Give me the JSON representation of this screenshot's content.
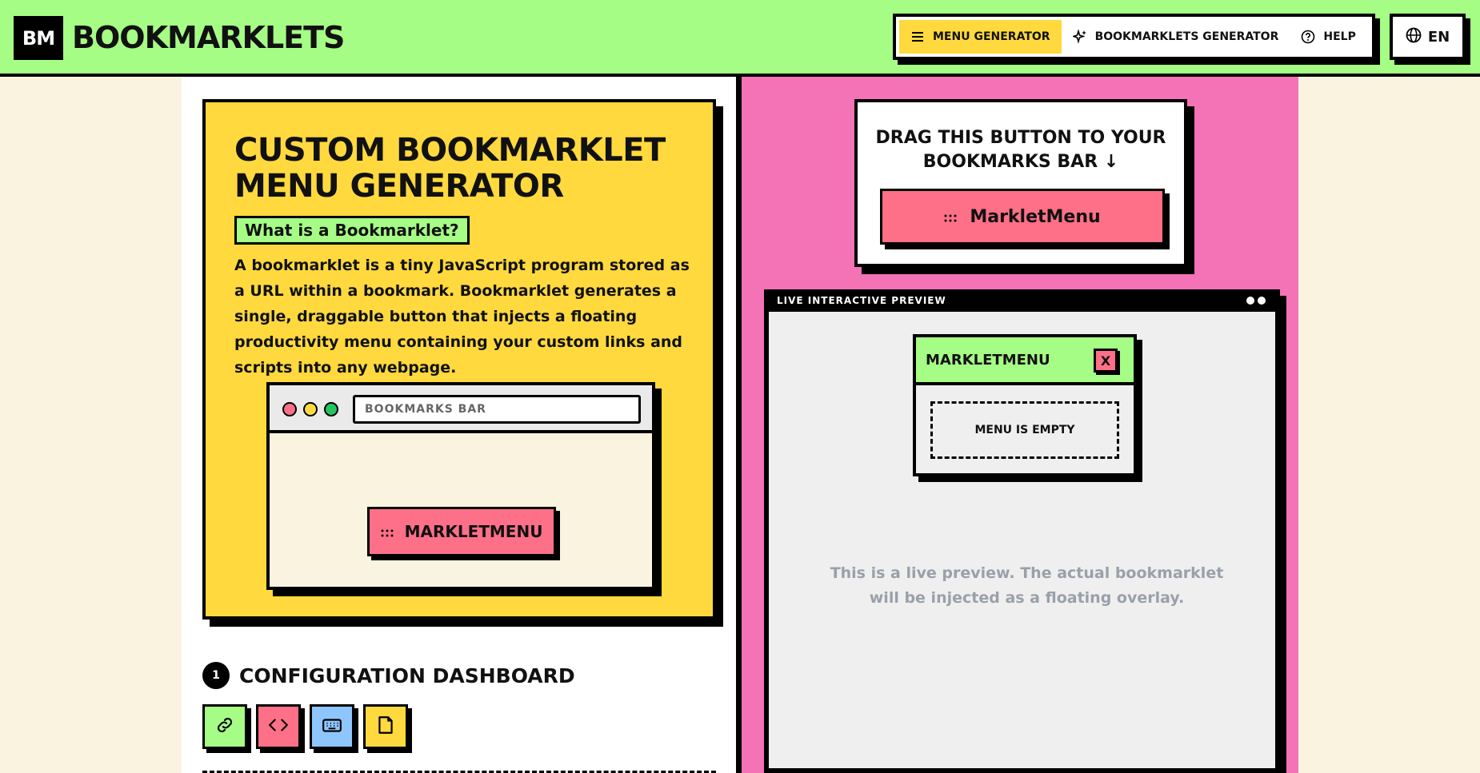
{
  "header": {
    "logo_mark": "BM",
    "logo_text": "BOOKMARKLETS",
    "nav": [
      {
        "label": "MENU GENERATOR",
        "icon": "menu-icon",
        "active": true
      },
      {
        "label": "BOOKMARKLETS GENERATOR",
        "icon": "sparkles-icon",
        "active": false
      },
      {
        "label": "HELP",
        "icon": "help-circle-icon",
        "active": false
      }
    ],
    "language": "EN",
    "language_icon": "globe-icon"
  },
  "hero": {
    "title": "CUSTOM BOOKMARKLET MENU GENERATOR",
    "badge": "What is a Bookmarklet?",
    "description": "A bookmarklet is a tiny JavaScript program stored as a URL within a bookmark. Bookmarklet generates a single, draggable button that injects a floating productivity menu containing your custom links and scripts into any webpage.",
    "browser": {
      "address_bar": "BOOKMARKS BAR",
      "demo_button": "MARKLETMENU"
    }
  },
  "config": {
    "step_number": "1",
    "title": "CONFIGURATION DASHBOARD",
    "tools": [
      {
        "icon": "link-icon",
        "color": "#a6fd86"
      },
      {
        "icon": "code-icon",
        "color": "#fe7087"
      },
      {
        "icon": "keyboard-icon",
        "color": "#8ec5fc"
      },
      {
        "icon": "note-icon",
        "color": "#ffd93d"
      }
    ]
  },
  "drag": {
    "instruction_line1": "DRAG THIS BUTTON TO YOUR",
    "instruction_line2": "BOOKMARKS BAR ↓",
    "button_label": "MarkletMenu"
  },
  "preview": {
    "header": "LIVE INTERACTIVE PREVIEW",
    "menu_title": "MARKLETMENU",
    "close_label": "X",
    "empty_label": "MENU IS EMPTY",
    "note": "This is a live preview. The actual bookmarklet will be injected as a floating overlay."
  },
  "colors": {
    "header_bg": "#a6fd86",
    "yellow": "#ffd93d",
    "pink": "#f472b6",
    "button_red": "#fe7087",
    "cream": "#faf3e0"
  }
}
